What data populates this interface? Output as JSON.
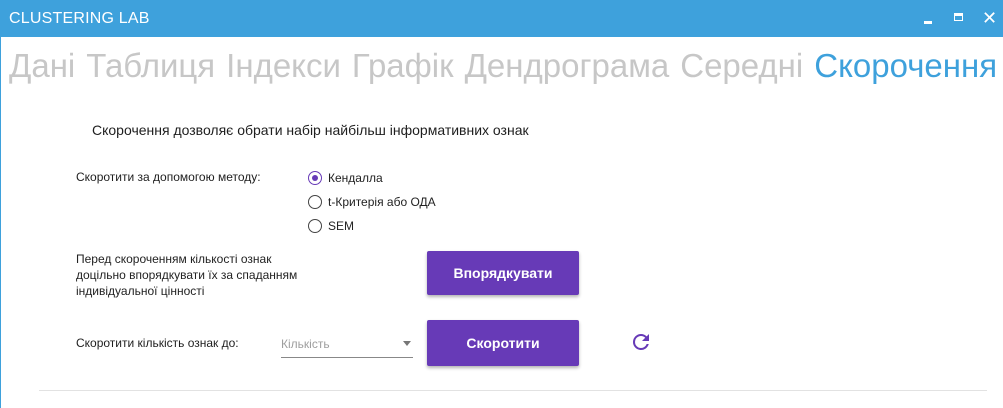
{
  "window": {
    "title": "CLUSTERING LAB",
    "controls": {
      "minimize": "minimize",
      "maximize": "maximize",
      "close": "close"
    },
    "accent_color": "#3ea1dc"
  },
  "tabs": [
    {
      "label": "Дані",
      "active": false
    },
    {
      "label": "Таблиця",
      "active": false
    },
    {
      "label": "Індекси",
      "active": false
    },
    {
      "label": "Графік",
      "active": false
    },
    {
      "label": "Дендрограма",
      "active": false
    },
    {
      "label": "Середні",
      "active": false
    },
    {
      "label": "Скорочення",
      "active": true
    }
  ],
  "main": {
    "description": "Скорочення дозволяє обрати набір найбільш інформативних ознак",
    "method_label": "Скоротити за допомогою методу:",
    "methods": [
      {
        "label": "Кендалла",
        "checked": true
      },
      {
        "label": "t-Критерія або ОДА",
        "checked": false
      },
      {
        "label": "SEM",
        "checked": false
      }
    ],
    "sort_hint_lines": [
      "Перед скороченням кількості ознак",
      "доцільно впорядкувати їх за спаданням",
      "індивідуальної цінності"
    ],
    "sort_button": "Впорядкувати",
    "reduce_label": "Скоротити кількість ознак до:",
    "count_placeholder": "Кількість",
    "reduce_button": "Скоротити",
    "refresh_icon": "refresh-icon",
    "button_color": "#673ab7"
  }
}
